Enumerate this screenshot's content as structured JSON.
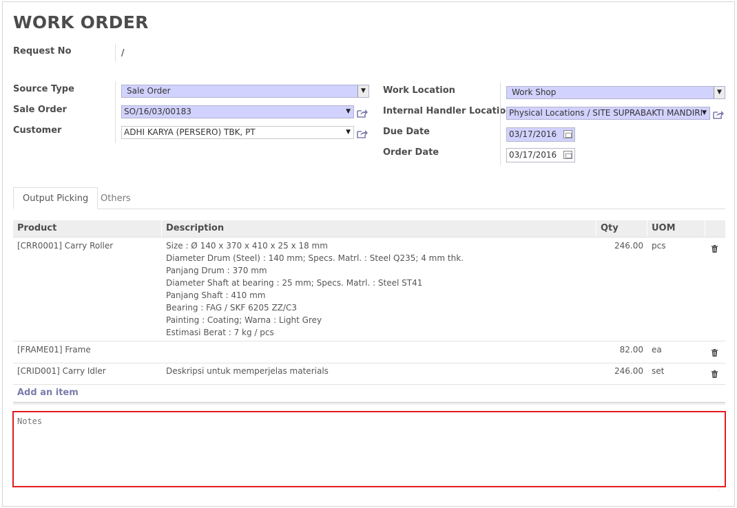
{
  "form": {
    "title": "WORK ORDER",
    "request_no": {
      "label": "Request No",
      "value": "/"
    }
  },
  "left_fields": {
    "source_type": {
      "label": "Source Type",
      "value": "Sale Order"
    },
    "sale_order": {
      "label": "Sale Order",
      "value": "SO/16/03/00183"
    },
    "customer": {
      "label": "Customer",
      "value": "ADHI KARYA (PERSERO) TBK, PT"
    }
  },
  "right_fields": {
    "work_location": {
      "label": "Work Location",
      "value": "Work Shop"
    },
    "internal_handler_location": {
      "label": "Internal Handler Location",
      "value": "Physical Locations / SITE SUPRABAKTI MANDIRI"
    },
    "due_date": {
      "label": "Due Date",
      "value": "03/17/2016"
    },
    "order_date": {
      "label": "Order Date",
      "value": "03/17/2016"
    }
  },
  "tabs": [
    {
      "label": "Output Picking",
      "active": true
    },
    {
      "label": "Others",
      "active": false
    }
  ],
  "table": {
    "headers": {
      "product": "Product",
      "description": "Description",
      "qty": "Qty",
      "uom": "UOM"
    },
    "rows": [
      {
        "product": "[CRR0001] Carry Roller",
        "description": [
          "Size : Ø 140 x 370 x 410 x 25 x 18 mm",
          "Diameter Drum (Steel) : 140 mm; Specs. Matrl. : Steel Q235; 4 mm thk.",
          "Panjang Drum : 370 mm",
          "Diameter Shaft at bearing : 25 mm; Specs. Matrl. : Steel ST41",
          "Panjang Shaft : 410 mm",
          "Bearing : FAG / SKF 6205 ZZ/C3",
          "Painting : Coating; Warna : Light Grey",
          "Estimasi Berat : 7 kg / pcs"
        ],
        "qty": "246.00",
        "uom": "pcs"
      },
      {
        "product": "[FRAME01] Frame",
        "description": [],
        "qty": "82.00",
        "uom": "ea"
      },
      {
        "product": "[CRID001] Carry Idler",
        "description": [
          "Deskripsi untuk memperjelas materials"
        ],
        "qty": "246.00",
        "uom": "set"
      }
    ],
    "add_item_label": "Add an item"
  },
  "notes": {
    "placeholder": "Notes",
    "value": ""
  },
  "colors": {
    "required_field": "#d2d2ff",
    "link": "#7c7bad",
    "highlight": "#e41a1c"
  },
  "icons": {
    "external_link": "external-link-icon",
    "calendar": "calendar-icon",
    "trash": "trash-icon",
    "dropdown": "chevron-down-icon"
  }
}
